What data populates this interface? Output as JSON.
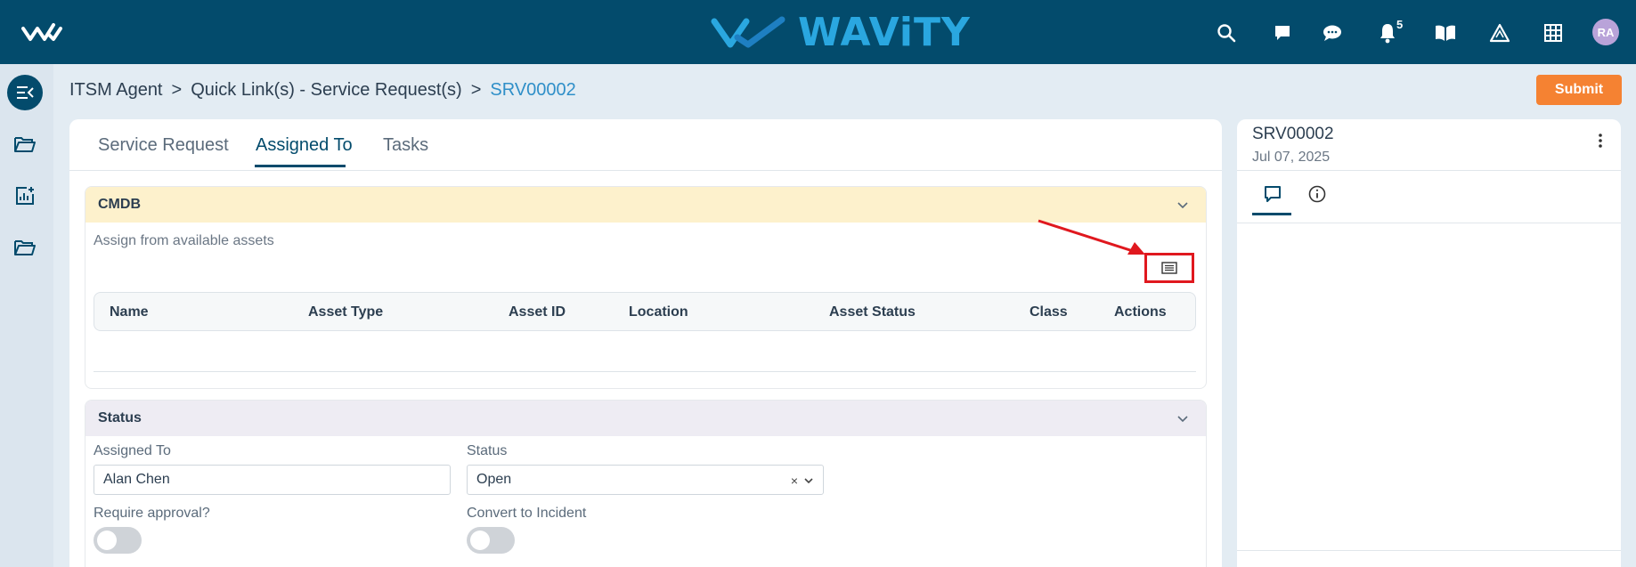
{
  "brand": {
    "name": "WAVITY",
    "display": "WAViTY"
  },
  "header": {
    "notification_count": "5",
    "avatar_initials": "RA",
    "icons": [
      "search-icon",
      "chat-icon",
      "message-icon",
      "bell-icon",
      "book-icon",
      "triangle-icon",
      "grid-icon"
    ]
  },
  "sidebar": {
    "items": [
      {
        "icon": "collapse-menu-icon"
      },
      {
        "icon": "folder-open-icon"
      },
      {
        "icon": "report-add-icon"
      },
      {
        "icon": "folder-open-icon"
      }
    ]
  },
  "breadcrumb": {
    "items": [
      "ITSM Agent",
      "Quick Link(s) - Service Request(s)",
      "SRV00002"
    ],
    "separator": ">"
  },
  "submit_label": "Submit",
  "tabs": [
    {
      "label": "Service Request",
      "active": false
    },
    {
      "label": "Assigned To",
      "active": true
    },
    {
      "label": "Tasks",
      "active": false
    }
  ],
  "cmdb": {
    "title": "CMDB",
    "subtitle": "Assign from available assets",
    "columns": [
      "Name",
      "Asset Type",
      "Asset ID",
      "Location",
      "Asset Status",
      "Class",
      "Actions"
    ]
  },
  "status_section": {
    "title": "Status",
    "assigned_to": {
      "label": "Assigned To",
      "value": "Alan Chen"
    },
    "status": {
      "label": "Status",
      "value": "Open",
      "clear": "×"
    },
    "require_approval": {
      "label": "Require approval?",
      "on": false
    },
    "convert_incident": {
      "label": "Convert to Incident",
      "on": false
    }
  },
  "side_panel": {
    "title": "SRV00002",
    "date": "Jul 07, 2025",
    "tabs": [
      "comment-icon",
      "info-icon"
    ]
  },
  "colors": {
    "topbar": "#034b6c",
    "accent": "#2f8fc8",
    "submit": "#f58232",
    "annotation": "#e0181e"
  }
}
